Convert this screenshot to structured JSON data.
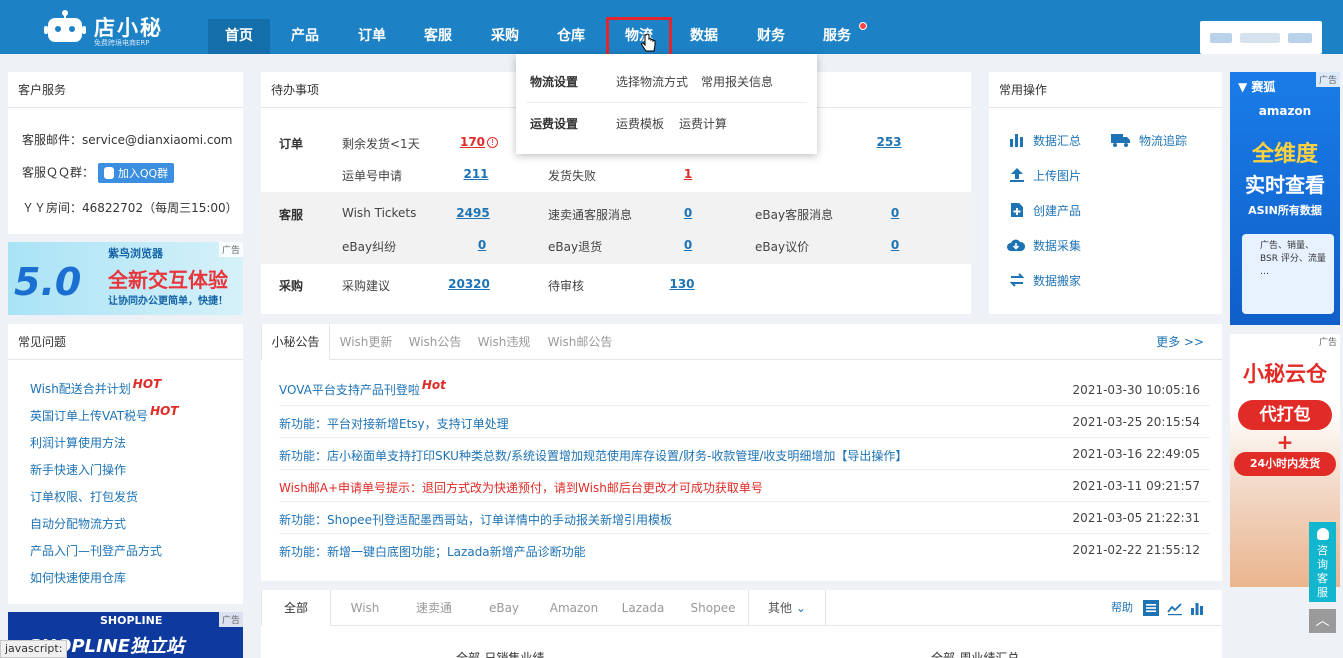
{
  "header": {
    "logo_title": "店小秘",
    "logo_sub": "免费跨境电商ERP",
    "nav": [
      {
        "label": "首页",
        "active": true
      },
      {
        "label": "产品"
      },
      {
        "label": "订单"
      },
      {
        "label": "客服"
      },
      {
        "label": "采购"
      },
      {
        "label": "仓库"
      },
      {
        "label": "物流",
        "highlighted": true
      },
      {
        "label": "数据"
      },
      {
        "label": "财务"
      },
      {
        "label": "服务",
        "badge": true
      }
    ]
  },
  "logistics_menu": {
    "groups": [
      {
        "title": "物流设置",
        "items": [
          "选择物流方式",
          "常用报关信息"
        ]
      },
      {
        "title": "运费设置",
        "items": [
          "运费模板",
          "运费计算"
        ]
      }
    ]
  },
  "customer_service": {
    "title": "客户服务",
    "email": "客服邮件：service@dianxiaomi.com",
    "qq_label": "客服ＱＱ群：",
    "qq_button": "加入QQ群",
    "yy": "ＹＹ房间：46822702（每周三15:00）"
  },
  "ad_browser": {
    "tag": "广告",
    "brand": "紫鸟浏览器",
    "version": "5.0",
    "headline": "全新交互体验",
    "sub": "让协同办公更简单，快捷！"
  },
  "faq": {
    "title": "常见问题",
    "items": [
      {
        "text": "Wish配送合并计划",
        "hot": "HOT"
      },
      {
        "text": "英国订单上传VAT税号",
        "hot": "HOT"
      },
      {
        "text": "利润计算使用方法"
      },
      {
        "text": "新手快速入门操作"
      },
      {
        "text": "订单权限、打包发货"
      },
      {
        "text": "自动分配物流方式"
      },
      {
        "text": "产品入门—刊登产品方式"
      },
      {
        "text": "如何快速使用仓库"
      }
    ]
  },
  "ad_shopline": {
    "tag": "广告",
    "brand": "SHOPLINE",
    "text": "SHOPLINE独立站"
  },
  "todo": {
    "title": "待办事项",
    "sections": [
      {
        "label": "订单",
        "rows": [
          [
            {
              "name": "剩余发货<1天",
              "value": "170",
              "red": true,
              "warn": true
            },
            {
              "name": "",
              "value": ""
            },
            {
              "name": "",
              "value": "253"
            }
          ],
          [
            {
              "name": "运单号申请",
              "value": "211"
            },
            {
              "name": "发货失败",
              "value": "1",
              "red": true
            }
          ]
        ]
      },
      {
        "label": "客服",
        "rows": [
          [
            {
              "name": "Wish Tickets",
              "value": "2495"
            },
            {
              "name": "速卖通客服消息",
              "value": "0"
            },
            {
              "name": "eBay客服消息",
              "value": "0"
            }
          ],
          [
            {
              "name": "eBay纠纷",
              "value": "0"
            },
            {
              "name": "eBay退货",
              "value": "0"
            },
            {
              "name": "eBay议价",
              "value": "0"
            }
          ]
        ]
      },
      {
        "label": "采购",
        "rows": [
          [
            {
              "name": "采购建议",
              "value": "20320"
            },
            {
              "name": "待审核",
              "value": "130"
            }
          ]
        ]
      }
    ]
  },
  "common_ops": {
    "title": "常用操作",
    "items": [
      {
        "label": "数据汇总",
        "icon": "bar-chart-icon"
      },
      {
        "label": "物流追踪",
        "icon": "truck-icon"
      },
      {
        "label": "上传图片",
        "icon": "upload-icon"
      },
      {
        "label": "创建产品",
        "icon": "add-file-icon"
      },
      {
        "label": "数据采集",
        "icon": "cloud-download-icon"
      },
      {
        "label": "数据搬家",
        "icon": "transfer-icon"
      }
    ]
  },
  "notices": {
    "tabs": [
      "小秘公告",
      "Wish更新",
      "Wish公告",
      "Wish违规",
      "Wish邮公告"
    ],
    "more": "更多 >>",
    "items": [
      {
        "text": "VOVA平台支持产品刊登啦",
        "hot": "Hot",
        "date": "2021-03-30 10:05:16"
      },
      {
        "text": "新功能：平台对接新增Etsy，支持订单处理",
        "date": "2021-03-25 20:15:54"
      },
      {
        "text": "新功能：店小秘面单支持打印SKU种类总数/系统设置增加规范使用库存设置/财务-收款管理/收支明细增加【导出操作】",
        "date": "2021-03-16 22:49:05"
      },
      {
        "text": "Wish邮A+申请单号提示：退回方式改为快递预付，请到Wish邮后台更改才可成功获取单号",
        "red": true,
        "date": "2021-03-11 09:21:57"
      },
      {
        "text": "新功能：Shopee刊登适配墨西哥站，订单详情中的手动报关新增引用模板",
        "date": "2021-03-05 21:22:31"
      },
      {
        "text": "新功能：新增一键白底图功能；Lazada新增产品诊断功能",
        "date": "2021-02-22 21:55:12"
      }
    ]
  },
  "sales": {
    "tabs": [
      "全部",
      "Wish",
      "速卖通",
      "eBay",
      "Amazon",
      "Lazada",
      "Shopee",
      "其他"
    ],
    "help": "帮助",
    "left_title": "全部-日销售业绩",
    "right_title": "全部-周业绩汇总"
  },
  "ad_amazon": {
    "tag": "广告",
    "brand": "赛狐",
    "amazon": "amazon",
    "line1": "全维度",
    "line2": "实时查看",
    "line3": "ASIN所有数据",
    "card": "广告、销量、BSR 评分、流量 …"
  },
  "ad_cloud": {
    "tag": "广告",
    "title": "小秘云仓",
    "line1": "代打包",
    "plus": "+",
    "line2": "24小时内发货"
  },
  "side": {
    "consult": "咨询客服"
  },
  "statusbar": {
    "text": "javascript:"
  },
  "colors": {
    "brand": "#1d81c6",
    "link": "#1e73b5",
    "hot": "#e02b26",
    "highlight_box": "#e3262b"
  }
}
